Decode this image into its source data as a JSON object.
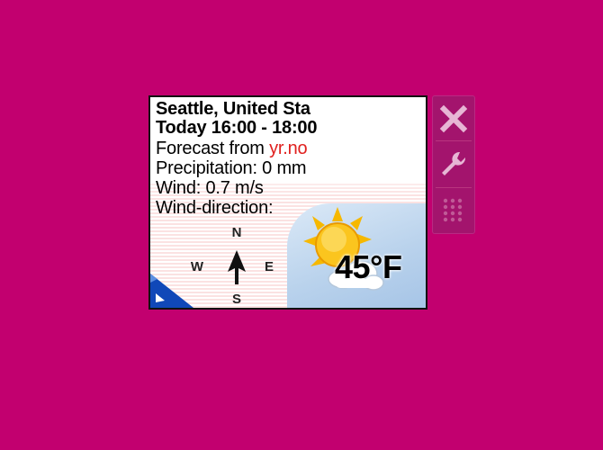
{
  "weather": {
    "location": "Seattle, United Sta",
    "time_range": "Today 16:00 - 18:00",
    "forecast_prefix": "Forecast from ",
    "forecast_source": "yr.no",
    "precipitation": "Precipitation: 0 mm",
    "wind": "Wind: 0.7 m/s",
    "wind_direction_label": "Wind-direction:",
    "temperature": "45°F",
    "condition_icon": "sun-cloud-icon"
  },
  "compass": {
    "north": "N",
    "south": "S",
    "east": "E",
    "west": "W",
    "arrow_icon": "wind-arrow-icon"
  },
  "toolbar": {
    "close_icon": "close-icon",
    "options_icon": "wrench-icon",
    "drag_icon": "drag-handle-icon"
  },
  "colors": {
    "desktop": "#c2006f",
    "link": "#e0201e",
    "toolbar": "#a3146d"
  }
}
